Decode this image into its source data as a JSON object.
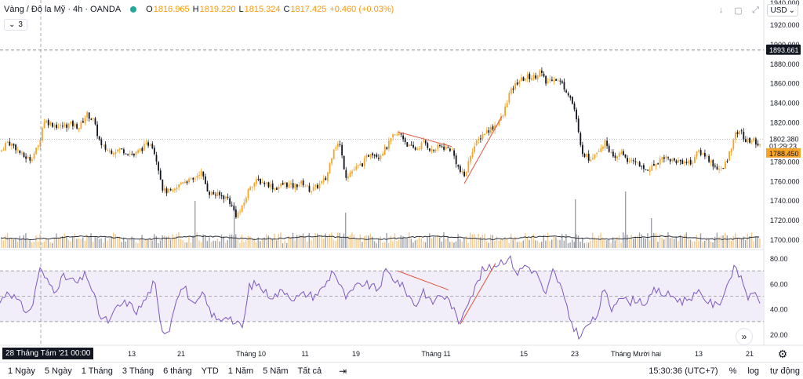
{
  "legend": {
    "symbol": "Vàng / Đô la Mỹ · 4h · OANDA",
    "open_label": "O",
    "open": "1816.965",
    "high_label": "H",
    "high": "1819.220",
    "low_label": "L",
    "low": "1815.324",
    "close_label": "C",
    "close": "1817.425",
    "change": "+0.460 (+0.03%)"
  },
  "indicator_toggle": {
    "chevron": "⌄",
    "count": "3"
  },
  "toolbar": {
    "currency": "USD"
  },
  "price_tags": {
    "dashed_level": "1893.661",
    "current": "1802.380",
    "countdown": "01:29:23",
    "lower": "1788.450"
  },
  "crosshair_date": "28 Tháng Tám '21   00:00",
  "bottom_bar": {
    "ranges": [
      "1 Ngày",
      "5 Ngày",
      "1 Tháng",
      "3 Tháng",
      "6 tháng",
      "YTD",
      "1 Năm",
      "5 Năm",
      "Tất cả"
    ],
    "time": "15:30:36 (UTC+7)",
    "percent": "%",
    "log": "log",
    "auto": "tự động"
  },
  "colors": {
    "up": "#f7a429",
    "down": "#131722",
    "rsi": "#7e57c2",
    "rsi_band": "#ede7f6",
    "trend": "#e0533b",
    "volume_up": "#f7c98a",
    "volume_down": "#9ea1a8",
    "ma": "#2a2e39"
  },
  "chart_data": {
    "type": "candlestick",
    "price_axis": {
      "ticks": [
        1700,
        1720,
        1740,
        1760,
        1780,
        1800,
        1820,
        1840,
        1860,
        1880,
        1900,
        1920
      ],
      "partial_ticks": [
        "1940.000"
      ],
      "range": [
        1693,
        1945
      ]
    },
    "rsi_axis": {
      "ticks": [
        20,
        40,
        60,
        80
      ],
      "range": [
        12,
        86
      ],
      "band": [
        30,
        70
      ],
      "mid": 50
    },
    "x_ticks": [
      {
        "label": "13",
        "x": 168
      },
      {
        "label": "21",
        "x": 231
      },
      {
        "label": "Tháng 10",
        "x": 320
      },
      {
        "label": "11",
        "x": 389
      },
      {
        "label": "19",
        "x": 454
      },
      {
        "label": "Tháng 11",
        "x": 556
      },
      {
        "label": "15",
        "x": 668
      },
      {
        "label": "23",
        "x": 733
      },
      {
        "label": "Tháng Mười hai",
        "x": 811
      },
      {
        "label": "13",
        "x": 891
      },
      {
        "label": "21",
        "x": 956
      }
    ],
    "close_path": [
      [
        0,
        1790
      ],
      [
        8,
        1800
      ],
      [
        18,
        1795
      ],
      [
        28,
        1785
      ],
      [
        38,
        1782
      ],
      [
        48,
        1795
      ],
      [
        55,
        1822
      ],
      [
        65,
        1818
      ],
      [
        75,
        1815
      ],
      [
        90,
        1818
      ],
      [
        100,
        1815
      ],
      [
        110,
        1828
      ],
      [
        118,
        1822
      ],
      [
        128,
        1795
      ],
      [
        140,
        1790
      ],
      [
        152,
        1792
      ],
      [
        160,
        1790
      ],
      [
        170,
        1786
      ],
      [
        180,
        1793
      ],
      [
        192,
        1800
      ],
      [
        200,
        1778
      ],
      [
        207,
        1750
      ],
      [
        220,
        1748
      ],
      [
        232,
        1760
      ],
      [
        245,
        1760
      ],
      [
        255,
        1770
      ],
      [
        265,
        1748
      ],
      [
        278,
        1745
      ],
      [
        290,
        1742
      ],
      [
        300,
        1725
      ],
      [
        307,
        1730
      ],
      [
        318,
        1755
      ],
      [
        328,
        1760
      ],
      [
        340,
        1757
      ],
      [
        350,
        1752
      ],
      [
        362,
        1757
      ],
      [
        372,
        1754
      ],
      [
        385,
        1758
      ],
      [
        395,
        1750
      ],
      [
        405,
        1755
      ],
      [
        415,
        1762
      ],
      [
        425,
        1795
      ],
      [
        432,
        1798
      ],
      [
        440,
        1765
      ],
      [
        452,
        1772
      ],
      [
        462,
        1778
      ],
      [
        472,
        1790
      ],
      [
        482,
        1785
      ],
      [
        493,
        1795
      ],
      [
        500,
        1805
      ],
      [
        510,
        1808
      ],
      [
        520,
        1795
      ],
      [
        530,
        1792
      ],
      [
        540,
        1800
      ],
      [
        550,
        1790
      ],
      [
        560,
        1795
      ],
      [
        575,
        1792
      ],
      [
        585,
        1770
      ],
      [
        592,
        1764
      ],
      [
        600,
        1790
      ],
      [
        608,
        1800
      ],
      [
        615,
        1808
      ],
      [
        628,
        1815
      ],
      [
        640,
        1825
      ],
      [
        648,
        1848
      ],
      [
        660,
        1862
      ],
      [
        672,
        1866
      ],
      [
        680,
        1866
      ],
      [
        688,
        1872
      ],
      [
        695,
        1860
      ],
      [
        705,
        1866
      ],
      [
        715,
        1860
      ],
      [
        725,
        1848
      ],
      [
        732,
        1832
      ],
      [
        740,
        1792
      ],
      [
        750,
        1782
      ],
      [
        762,
        1792
      ],
      [
        772,
        1800
      ],
      [
        782,
        1780
      ],
      [
        792,
        1790
      ],
      [
        802,
        1778
      ],
      [
        812,
        1780
      ],
      [
        820,
        1770
      ],
      [
        832,
        1775
      ],
      [
        845,
        1785
      ],
      [
        858,
        1780
      ],
      [
        870,
        1780
      ],
      [
        880,
        1778
      ],
      [
        890,
        1790
      ],
      [
        900,
        1785
      ],
      [
        910,
        1775
      ],
      [
        920,
        1770
      ],
      [
        928,
        1785
      ],
      [
        935,
        1805
      ],
      [
        942,
        1812
      ],
      [
        950,
        1800
      ],
      [
        960,
        1802
      ],
      [
        970,
        1795
      ]
    ],
    "rsi_path": [
      [
        0,
        45
      ],
      [
        10,
        55
      ],
      [
        20,
        48
      ],
      [
        30,
        40
      ],
      [
        40,
        38
      ],
      [
        50,
        72
      ],
      [
        60,
        62
      ],
      [
        70,
        55
      ],
      [
        80,
        65
      ],
      [
        90,
        63
      ],
      [
        100,
        60
      ],
      [
        110,
        68
      ],
      [
        120,
        50
      ],
      [
        128,
        33
      ],
      [
        140,
        30
      ],
      [
        150,
        42
      ],
      [
        162,
        45
      ],
      [
        175,
        38
      ],
      [
        188,
        50
      ],
      [
        197,
        62
      ],
      [
        205,
        25
      ],
      [
        215,
        22
      ],
      [
        225,
        50
      ],
      [
        235,
        58
      ],
      [
        248,
        40
      ],
      [
        258,
        52
      ],
      [
        268,
        38
      ],
      [
        278,
        30
      ],
      [
        290,
        36
      ],
      [
        300,
        28
      ],
      [
        310,
        26
      ],
      [
        318,
        58
      ],
      [
        328,
        60
      ],
      [
        340,
        52
      ],
      [
        350,
        50
      ],
      [
        362,
        55
      ],
      [
        375,
        48
      ],
      [
        390,
        52
      ],
      [
        400,
        50
      ],
      [
        410,
        55
      ],
      [
        418,
        62
      ],
      [
        425,
        72
      ],
      [
        432,
        60
      ],
      [
        442,
        48
      ],
      [
        452,
        56
      ],
      [
        462,
        60
      ],
      [
        472,
        58
      ],
      [
        482,
        55
      ],
      [
        492,
        70
      ],
      [
        500,
        65
      ],
      [
        510,
        60
      ],
      [
        520,
        52
      ],
      [
        530,
        42
      ],
      [
        540,
        55
      ],
      [
        550,
        44
      ],
      [
        562,
        52
      ],
      [
        575,
        45
      ],
      [
        585,
        28
      ],
      [
        595,
        45
      ],
      [
        605,
        55
      ],
      [
        615,
        70
      ],
      [
        625,
        72
      ],
      [
        632,
        75
      ],
      [
        640,
        78
      ],
      [
        650,
        80
      ],
      [
        660,
        68
      ],
      [
        670,
        75
      ],
      [
        680,
        70
      ],
      [
        688,
        65
      ],
      [
        695,
        48
      ],
      [
        705,
        70
      ],
      [
        715,
        58
      ],
      [
        725,
        35
      ],
      [
        732,
        25
      ],
      [
        740,
        18
      ],
      [
        750,
        28
      ],
      [
        760,
        32
      ],
      [
        770,
        55
      ],
      [
        780,
        40
      ],
      [
        790,
        52
      ],
      [
        800,
        45
      ],
      [
        812,
        48
      ],
      [
        825,
        44
      ],
      [
        835,
        55
      ],
      [
        845,
        52
      ],
      [
        858,
        50
      ],
      [
        870,
        46
      ],
      [
        882,
        50
      ],
      [
        892,
        52
      ],
      [
        905,
        45
      ],
      [
        915,
        42
      ],
      [
        925,
        55
      ],
      [
        935,
        72
      ],
      [
        945,
        65
      ],
      [
        955,
        48
      ],
      [
        965,
        52
      ],
      [
        970,
        46
      ]
    ],
    "trendlines_price": [
      {
        "x1": 507,
        "y1": 1810,
        "x2": 576,
        "y2": 1795
      },
      {
        "x1": 592,
        "y1": 1757,
        "x2": 640,
        "y2": 1826
      }
    ],
    "trendlines_rsi": [
      {
        "x1": 507,
        "y1": 70,
        "x2": 572,
        "y2": 55
      },
      {
        "x1": 587,
        "y1": 28,
        "x2": 632,
        "y2": 76
      }
    ],
    "volume_spikes": [
      {
        "x": 248,
        "h": 60
      },
      {
        "x": 298,
        "h": 52
      },
      {
        "x": 440,
        "h": 45
      },
      {
        "x": 733,
        "h": 62
      },
      {
        "x": 797,
        "h": 72
      },
      {
        "x": 830,
        "h": 38
      }
    ]
  }
}
